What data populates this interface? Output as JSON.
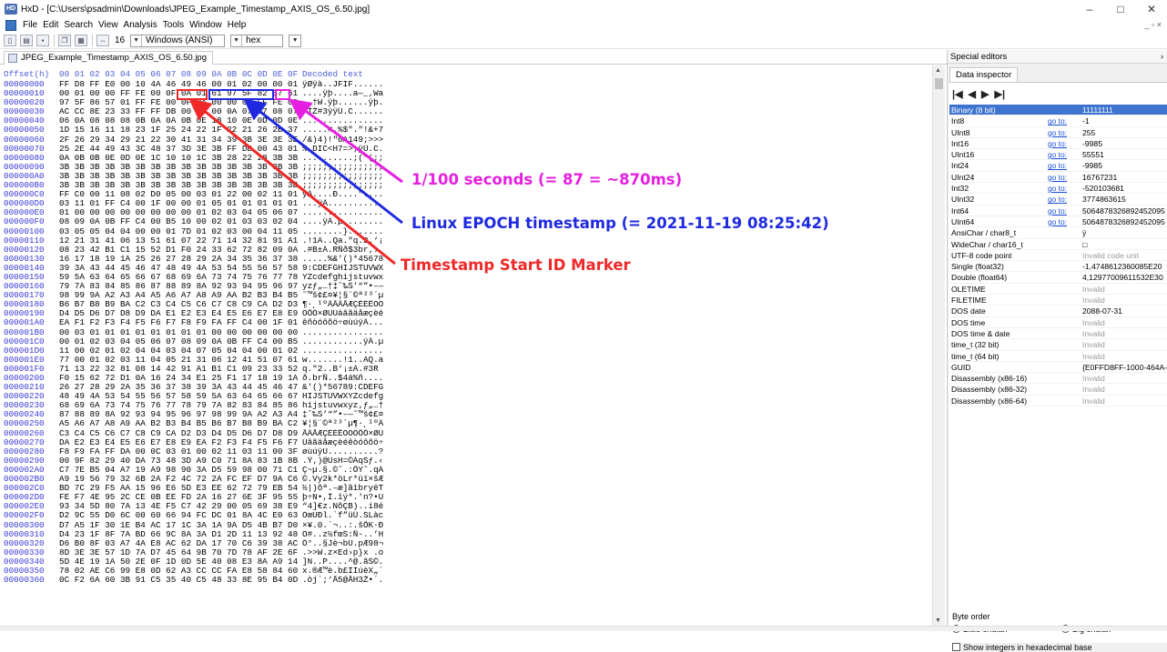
{
  "window": {
    "title": "HxD - [C:\\Users\\psadmin\\Downloads\\JPEG_Example_Timestamp_AXIS_OS_6.50.jpg]",
    "minimize": "–",
    "maximize": "□",
    "close": "✕",
    "mdi_controls": "_ ▫ ×"
  },
  "menu": [
    "File",
    "Edit",
    "Search",
    "View",
    "Analysis",
    "Tools",
    "Window",
    "Help"
  ],
  "toolbar": {
    "bytes_per_row": "16",
    "charset": "Windows (ANSI)",
    "display_mode": "hex"
  },
  "tab": {
    "label": "JPEG_Example_Timestamp_AXIS_OS_6.50.jpg"
  },
  "hex": {
    "header_offset": "Offset(h)",
    "header_cols": "00 01 02 03 04 05 06 07 08 09 0A 0B 0C 0D 0E 0F",
    "header_decoded": "Decoded text",
    "rows": [
      {
        "o": "00000000",
        "h": "FF D8 FF E0 00 10 4A 46 49 46 00 01 02 00 00 01",
        "t": "ÿØÿà..JFIF......"
      },
      {
        "o": "00000010",
        "h": "00 01 00 00 FF FE 00 0F 0A 01 61 97 5F 82 57 61",
        "t": "....ÿþ....a—_‚Wa"
      },
      {
        "o": "00000020",
        "h": "97 5F 86 57 01 FF FE 00 0F 0A 00 00 0A FF FE 00",
        "t": "—_†W.ÿþ......ÿþ."
      },
      {
        "o": "00000030",
        "h": "AC CC 8E 23 33 FF FF DB 00 43 00 0A 07 07 08 07",
        "t": "¬ÌŽ#3ÿÿÛ.C......"
      },
      {
        "o": "00000040",
        "h": "06 0A 08 08 08 0B 0A 0A 0B 0E 18 10 0E 0D 0D 0E",
        "t": "................"
      },
      {
        "o": "00000050",
        "h": "1D 15 16 11 18 23 1F 25 24 22 1F 22 21 26 2B 37",
        "t": ".....#.%$\".\"!&+7"
      },
      {
        "o": "00000060",
        "h": "2F 26 29 34 29 21 22 30 41 31 34 39 3B 3E 3E 3E",
        "t": "/&)4)!\"0A149;>>>"
      },
      {
        "o": "00000070",
        "h": "25 2E 44 49 43 3C 48 37 3D 3E 3B FF DB 00 43 01",
        "t": "%.DIC<H7=>;ÿÛ.C."
      },
      {
        "o": "00000080",
        "h": "0A 0B 0B 0E 0D 0E 1C 10 10 1C 3B 28 22 28 3B 3B",
        "t": "..........;(\"(;;"
      },
      {
        "o": "00000090",
        "h": "3B 3B 3B 3B 3B 3B 3B 3B 3B 3B 3B 3B 3B 3B 3B 3B",
        "t": ";;;;;;;;;;;;;;;;"
      },
      {
        "o": "000000A0",
        "h": "3B 3B 3B 3B 3B 3B 3B 3B 3B 3B 3B 3B 3B 3B 3B 3B",
        "t": ";;;;;;;;;;;;;;;;"
      },
      {
        "o": "000000B0",
        "h": "3B 3B 3B 3B 3B 3B 3B 3B 3B 3B 3B 3B 3B 3B 3B 3B",
        "t": ";;;;;;;;;;;;;;;;"
      },
      {
        "o": "000000C0",
        "h": "FF C0 00 11 08 02 D0 05 00 03 01 22 00 02 11 01",
        "t": "ÿÀ....Ð....\"...."
      },
      {
        "o": "000000D0",
        "h": "03 11 01 FF C4 00 1F 00 00 01 05 01 01 01 01 01",
        "t": "...ÿÄ..........."
      },
      {
        "o": "000000E0",
        "h": "01 00 00 00 00 00 00 00 00 01 02 03 04 05 06 07",
        "t": "................"
      },
      {
        "o": "000000F0",
        "h": "08 09 0A 0B FF C4 00 B5 10 00 02 01 03 03 02 04",
        "t": "....ÿÄ.µ........"
      },
      {
        "o": "00000100",
        "h": "03 05 05 04 04 00 00 01 7D 01 02 03 00 04 11 05",
        "t": "........}......."
      },
      {
        "o": "00000110",
        "h": "12 21 31 41 06 13 51 61 07 22 71 14 32 81 91 A1",
        "t": ".!1A..Qa.\"q.2.‘¡"
      },
      {
        "o": "00000120",
        "h": "08 23 42 B1 C1 15 52 D1 F0 24 33 62 72 82 09 0A",
        "t": ".#B±Á.RÑð$3br‚.."
      },
      {
        "o": "00000130",
        "h": "16 17 18 19 1A 25 26 27 28 29 2A 34 35 36 37 38",
        "t": ".....%&'()*45678"
      },
      {
        "o": "00000140",
        "h": "39 3A 43 44 45 46 47 48 49 4A 53 54 55 56 57 58",
        "t": "9:CDEFGHIJSTUVWX"
      },
      {
        "o": "00000150",
        "h": "59 5A 63 64 65 66 67 68 69 6A 73 74 75 76 77 78",
        "t": "YZcdefghijstuvwx"
      },
      {
        "o": "00000160",
        "h": "79 7A 83 84 85 86 87 88 89 8A 92 93 94 95 96 97",
        "t": "yzƒ„…†‡ˆ‰Š’“”•–—"
      },
      {
        "o": "00000170",
        "h": "98 99 9A A2 A3 A4 A5 A6 A7 A8 A9 AA B2 B3 B4 B5",
        "t": "˜™š¢£¤¥¦§¨©ª²³´µ"
      },
      {
        "o": "00000180",
        "h": "B6 B7 B8 B9 BA C2 C3 C4 C5 C6 C7 C8 C9 CA D2 D3",
        "t": "¶·¸¹ºÂÃÄÅÆÇÈÉÊÒÓ"
      },
      {
        "o": "00000190",
        "h": "D4 D5 D6 D7 D8 D9 DA E1 E2 E3 E4 E5 E6 E7 E8 E9",
        "t": "ÔÕÖ×ØÙÚáâãäåæçèé"
      },
      {
        "o": "000001A0",
        "h": "EA F1 F2 F3 F4 F5 F6 F7 F8 F9 FA FF C4 00 1F 01",
        "t": "êñòóôõö÷øùúÿÄ..."
      },
      {
        "o": "000001B0",
        "h": "00 03 01 01 01 01 01 01 01 01 00 00 00 00 00 00",
        "t": "................"
      },
      {
        "o": "000001C0",
        "h": "00 01 02 03 04 05 06 07 08 09 0A 0B FF C4 00 B5",
        "t": "............ÿÄ.µ"
      },
      {
        "o": "000001D0",
        "h": "11 00 02 01 02 04 04 03 04 07 05 04 04 00 01 02",
        "t": "................"
      },
      {
        "o": "000001E0",
        "h": "77 00 01 02 03 11 04 05 21 31 06 12 41 51 07 61",
        "t": "w.......!1..AQ.a"
      },
      {
        "o": "000001F0",
        "h": "71 13 22 32 81 08 14 42 91 A1 B1 C1 09 23 33 52",
        "t": "q.\"2..B‘¡±Á.#3R"
      },
      {
        "o": "00000200",
        "h": "F0 15 62 72 D1 0A 16 24 34 E1 25 F1 17 18 19 1A",
        "t": "ð.brÑ..$4á%ñ...."
      },
      {
        "o": "00000210",
        "h": "26 27 28 29 2A 35 36 37 38 39 3A 43 44 45 46 47",
        "t": "&'()*56789:CDEFG"
      },
      {
        "o": "00000220",
        "h": "48 49 4A 53 54 55 56 57 58 59 5A 63 64 65 66 67",
        "t": "HIJSTUVWXYZcdefg"
      },
      {
        "o": "00000230",
        "h": "68 69 6A 73 74 75 76 77 78 79 7A 82 83 84 85 86",
        "t": "hijstuvwxyz‚ƒ„…†"
      },
      {
        "o": "00000240",
        "h": "87 88 89 8A 92 93 94 95 96 97 98 99 9A A2 A3 A4",
        "t": "‡ˆ‰Š’“”•–—˜™š¢£¤"
      },
      {
        "o": "00000250",
        "h": "A5 A6 A7 A8 A9 AA B2 B3 B4 B5 B6 B7 B8 B9 BA C2",
        "t": "¥¦§¨©ª²³´µ¶·¸¹ºÂ"
      },
      {
        "o": "00000260",
        "h": "C3 C4 C5 C6 C7 C8 C9 CA D2 D3 D4 D5 D6 D7 D8 D9",
        "t": "ÃÄÅÆÇÈÉÊÒÓÔÕÖ×ØÙ"
      },
      {
        "o": "00000270",
        "h": "DA E2 E3 E4 E5 E6 E7 E8 E9 EA F2 F3 F4 F5 F6 F7",
        "t": "Úâãäåæçèéêòóôõö÷"
      },
      {
        "o": "00000280",
        "h": "F8 F9 FA FF DA 00 0C 03 01 00 02 11 03 11 00 3F",
        "t": "øùúÿÚ..........?"
      },
      {
        "o": "00000290",
        "h": "00 9F 82 29 40 DA 73 48 3D A9 C0 71 8A 83 1B 8B",
        "t": ".Ÿ‚)@ÚsH=©ÀqŠƒ.‹"
      },
      {
        "o": "000002A0",
        "h": "C7 7E B5 04 A7 19 A9 98 90 3A D5 59 98 00 71 C1",
        "t": "Ç~µ.§.©˜.:ÕY˜.qÁ"
      },
      {
        "o": "000002B0",
        "h": "A9 19 56 79 32 6B 2A F2 4C 72 2A FC EF D7 9A C6",
        "t": "©.Vy2k*òLr*üï×šÆ"
      },
      {
        "o": "000002C0",
        "h": "BD 7C 29 F5 AA 15 96 E6 5D E3 EE 62 72 79 EB 54",
        "t": "½|)õª.–æ]ãîbryëT"
      },
      {
        "o": "000002D0",
        "h": "FE F7 4E 95 2C CE 0B EE FD 2A 16 27 6E 3F 95 55",
        "t": "þ÷N•,Î.îý*.'n?•U"
      },
      {
        "o": "000002E0",
        "h": "93 34 5D 80 7A 13 4E F5 C7 42 29 00 05 69 38 E9",
        "t": "“4]€z.NõÇB)..i8é"
      },
      {
        "o": "000002F0",
        "h": "D2 9C 55 D0 6C 00 60 66 94 FC DC 01 8A 4C E0 63",
        "t": "ÒœUÐl.`f”üÜ.ŠLàc"
      },
      {
        "o": "00000300",
        "h": "D7 A5 1F 30 1E B4 AC 17 1C 3A 1A 9A D5 4B B7 D0",
        "t": "×¥.0.´¬..:.šÕK·Ð"
      },
      {
        "o": "00000310",
        "h": "D4 23 1F 8F 7A BD 66 9C 8A 3A D1 2D 11 13 92 48",
        "t": "Ô#..z½fœŠ:Ñ-..’H"
      },
      {
        "o": "00000320",
        "h": "D6 B0 8F 03 A7 4A E8 AC 62 DA 17 70 C6 39 38 AC",
        "t": "Ö°..§Jè¬bÚ.pÆ98¬"
      },
      {
        "o": "00000330",
        "h": "8D 3E 3E 57 1D 7A D7 45 64 9B 70 7D 78 AF 2E 6F",
        "t": ".>>W.z×Ed›p}x¯.o"
      },
      {
        "o": "00000340",
        "h": "5D 4E 19 1A 50 2E 0F 1D 0D 5E 40 08 E3 8A A9 14",
        "t": "]N..P....^@.ãŠ©."
      },
      {
        "o": "00000350",
        "h": "78 02 AE C6 99 E8 0D 62 A3 CC CC FA E8 58 84 60",
        "t": "x.®Æ™è.b£ÌÌúèX„`"
      },
      {
        "o": "00000360",
        "h": "0C F2 6A 60 3B 91 C5 35 40 C5 48 33 8E 95 B4 0D",
        "t": ".òj`;‘Å5@ÅH3Ž•´."
      }
    ]
  },
  "annotations": {
    "seconds": "1/100 seconds (= 87 = ~870ms)",
    "epoch": "Linux EPOCH timestamp (= 2021-11-19 08:25:42)",
    "marker": "Timestamp Start ID Marker",
    "colors": {
      "seconds": "#e61fe0",
      "epoch": "#1f2ae0",
      "marker": "#f02828"
    }
  },
  "special_editors": {
    "title": "Special editors",
    "tab": "Data inspector",
    "nav": [
      "|◀",
      "◀",
      "▶",
      "▶|"
    ],
    "goto_label": "go to:",
    "rows": [
      {
        "name": "Binary (8 bit)",
        "goto": false,
        "value": "11111111",
        "selected": true
      },
      {
        "name": "Int8",
        "goto": true,
        "value": "-1"
      },
      {
        "name": "UInt8",
        "goto": true,
        "value": "255"
      },
      {
        "name": "Int16",
        "goto": true,
        "value": "-9985"
      },
      {
        "name": "UInt16",
        "goto": true,
        "value": "55551"
      },
      {
        "name": "Int24",
        "goto": true,
        "value": "-9985"
      },
      {
        "name": "UInt24",
        "goto": true,
        "value": "16767231"
      },
      {
        "name": "Int32",
        "goto": true,
        "value": "-520103681"
      },
      {
        "name": "UInt32",
        "goto": true,
        "value": "3774863615"
      },
      {
        "name": "Int64",
        "goto": true,
        "value": "5064878326892452095"
      },
      {
        "name": "UInt64",
        "goto": true,
        "value": "5064878326892452095"
      },
      {
        "name": "AnsiChar / char8_t",
        "goto": false,
        "value": "ÿ"
      },
      {
        "name": "WideChar / char16_t",
        "goto": false,
        "value": "□"
      },
      {
        "name": "UTF-8 code point",
        "goto": false,
        "value": "Invalid code unit",
        "invalid": true
      },
      {
        "name": "Single (float32)",
        "goto": false,
        "value": "-1,4748612360085E20"
      },
      {
        "name": "Double (float64)",
        "goto": false,
        "value": "4,12977009611532E30"
      },
      {
        "name": "OLETIME",
        "goto": false,
        "value": "Invalid",
        "invalid": true
      },
      {
        "name": "FILETIME",
        "goto": false,
        "value": "Invalid",
        "invalid": true
      },
      {
        "name": "DOS date",
        "goto": false,
        "value": "2088-07-31"
      },
      {
        "name": "DOS time",
        "goto": false,
        "value": "Invalid",
        "invalid": true
      },
      {
        "name": "DOS time & date",
        "goto": false,
        "value": "Invalid",
        "invalid": true
      },
      {
        "name": "time_t (32 bit)",
        "goto": false,
        "value": "Invalid",
        "invalid": true
      },
      {
        "name": "time_t (64 bit)",
        "goto": false,
        "value": "Invalid",
        "invalid": true
      },
      {
        "name": "GUID",
        "goto": false,
        "value": "{E0FFD8FF-1000-464A-4946-00010"
      },
      {
        "name": "Disassembly (x86-16)",
        "goto": false,
        "value": "Invalid",
        "invalid": true
      },
      {
        "name": "Disassembly (x86-32)",
        "goto": false,
        "value": "Invalid",
        "invalid": true
      },
      {
        "name": "Disassembly (x86-64)",
        "goto": false,
        "value": "Invalid",
        "invalid": true
      }
    ],
    "byte_order_label": "Byte order",
    "little_endian": "Little endian",
    "big_endian": "Big endian",
    "hex_checkbox": "Show integers in hexadecimal base"
  }
}
